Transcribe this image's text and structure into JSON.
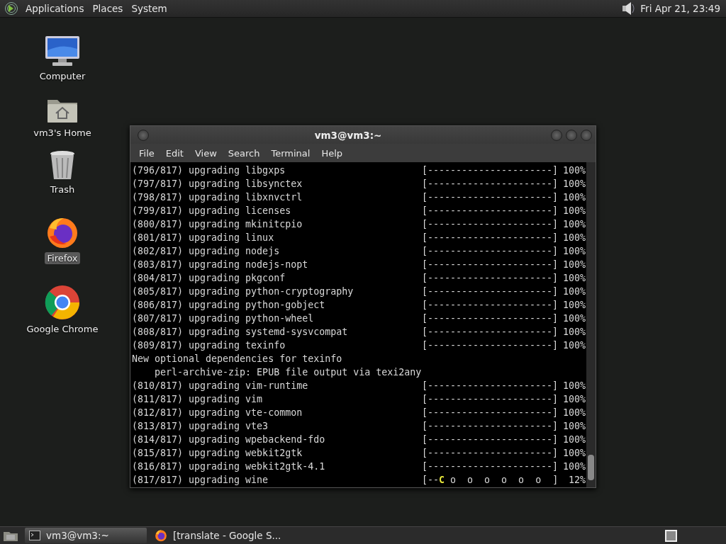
{
  "top_panel": {
    "menus": [
      "Applications",
      "Places",
      "System"
    ],
    "clock": "Fri Apr 21, 23:49"
  },
  "desktop_icons": [
    {
      "kind": "computer",
      "label": "Computer",
      "selected": false
    },
    {
      "kind": "home",
      "label": "vm3's Home",
      "selected": false
    },
    {
      "kind": "trash",
      "label": "Trash",
      "selected": false
    },
    {
      "kind": "firefox",
      "label": "Firefox",
      "selected": true
    },
    {
      "kind": "chrome",
      "label": "Google Chrome",
      "selected": false
    }
  ],
  "terminal": {
    "title": "vm3@vm3:~",
    "menu": [
      "File",
      "Edit",
      "View",
      "Search",
      "Terminal",
      "Help"
    ],
    "lines": [
      {
        "kind": "progress",
        "text": "(796/817) upgrading libgxps",
        "bar": "[----------------------]",
        "percent": "100%"
      },
      {
        "kind": "progress",
        "text": "(797/817) upgrading libsynctex",
        "bar": "[----------------------]",
        "percent": "100%"
      },
      {
        "kind": "progress",
        "text": "(798/817) upgrading libxnvctrl",
        "bar": "[----------------------]",
        "percent": "100%"
      },
      {
        "kind": "progress",
        "text": "(799/817) upgrading licenses",
        "bar": "[----------------------]",
        "percent": "100%"
      },
      {
        "kind": "progress",
        "text": "(800/817) upgrading mkinitcpio",
        "bar": "[----------------------]",
        "percent": "100%"
      },
      {
        "kind": "progress",
        "text": "(801/817) upgrading linux",
        "bar": "[----------------------]",
        "percent": "100%"
      },
      {
        "kind": "progress",
        "text": "(802/817) upgrading nodejs",
        "bar": "[----------------------]",
        "percent": "100%"
      },
      {
        "kind": "progress",
        "text": "(803/817) upgrading nodejs-nopt",
        "bar": "[----------------------]",
        "percent": "100%"
      },
      {
        "kind": "progress",
        "text": "(804/817) upgrading pkgconf",
        "bar": "[----------------------]",
        "percent": "100%"
      },
      {
        "kind": "progress",
        "text": "(805/817) upgrading python-cryptography",
        "bar": "[----------------------]",
        "percent": "100%"
      },
      {
        "kind": "progress",
        "text": "(806/817) upgrading python-gobject",
        "bar": "[----------------------]",
        "percent": "100%"
      },
      {
        "kind": "progress",
        "text": "(807/817) upgrading python-wheel",
        "bar": "[----------------------]",
        "percent": "100%"
      },
      {
        "kind": "progress",
        "text": "(808/817) upgrading systemd-sysvcompat",
        "bar": "[----------------------]",
        "percent": "100%"
      },
      {
        "kind": "progress",
        "text": "(809/817) upgrading texinfo",
        "bar": "[----------------------]",
        "percent": "100%"
      },
      {
        "kind": "text",
        "text": "New optional dependencies for texinfo"
      },
      {
        "kind": "text",
        "text": "    perl-archive-zip: EPUB file output via texi2any"
      },
      {
        "kind": "progress",
        "text": "(810/817) upgrading vim-runtime",
        "bar": "[----------------------]",
        "percent": "100%"
      },
      {
        "kind": "progress",
        "text": "(811/817) upgrading vim",
        "bar": "[----------------------]",
        "percent": "100%"
      },
      {
        "kind": "progress",
        "text": "(812/817) upgrading vte-common",
        "bar": "[----------------------]",
        "percent": "100%"
      },
      {
        "kind": "progress",
        "text": "(813/817) upgrading vte3",
        "bar": "[----------------------]",
        "percent": "100%"
      },
      {
        "kind": "progress",
        "text": "(814/817) upgrading wpebackend-fdo",
        "bar": "[----------------------]",
        "percent": "100%"
      },
      {
        "kind": "progress",
        "text": "(815/817) upgrading webkit2gtk",
        "bar": "[----------------------]",
        "percent": "100%"
      },
      {
        "kind": "progress",
        "text": "(816/817) upgrading webkit2gtk-4.1",
        "bar": "[----------------------]",
        "percent": "100%"
      },
      {
        "kind": "pacman",
        "text": "(817/817) upgrading wine",
        "bar": "[--",
        "pacman": "C",
        "rest": "o  o  o  o  o  o  ]",
        "percent": "12%"
      }
    ]
  },
  "taskbar": {
    "tasks": [
      {
        "kind": "terminal",
        "label": "vm3@vm3:~",
        "selected": true
      },
      {
        "kind": "firefox",
        "label": "[translate - Google S...",
        "selected": false
      }
    ]
  }
}
